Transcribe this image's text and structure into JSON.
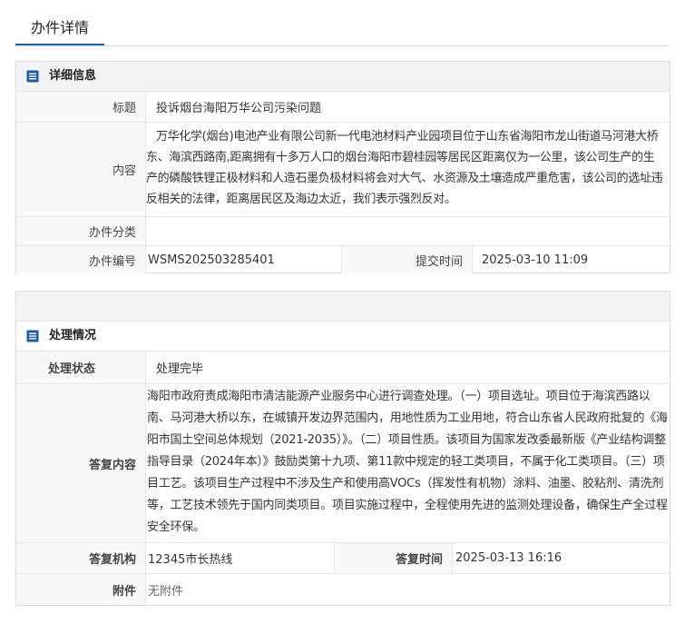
{
  "page_tab": "办件详情",
  "details": {
    "section_title": "详细信息",
    "title_label": "标题",
    "title_value": "投诉烟台海阳万华公司污染问题",
    "content_label": "内容",
    "content_value": "万华化学(烟台)电池产业有限公司新一代电池材料产业园项目位于山东省海阳市龙山街道马河港大桥东、海滨西路南,距离拥有十多万人口的烟台海阳市碧桂园等居民区距离仅为一公里，该公司生产的生产的磷酸铁锂正极材料和人造石墨负极材料将会对大气、水资源及土壤造成严重危害，该公司的选址违反相关的法律，距离居民区及海边太近，我们表示强烈反对。",
    "category_label": "办件分类",
    "category_value": "",
    "number_label": "办件编号",
    "number_value": "WSMS202503285401",
    "submit_time_label": "提交时间",
    "submit_time_value": "2025-03-10 11:09"
  },
  "handling": {
    "section_title": "处理情况",
    "status_label": "处理状态",
    "status_value": "处理完毕",
    "reply_label": "答复内容",
    "reply_value": "海阳市政府责成海阳市清洁能源产业服务中心进行调查处理。（一）项目选址。项目位于海滨西路以南、马河港大桥以东，在城镇开发边界范围内，用地性质为工业用地，符合山东省人民政府批复的《海阳市国土空间总体规划（2021-2035）》。（二）项目性质。该项目为国家发改委最新版《产业结构调整指导目录（2024年本）》鼓励类第十九项、第11款中规定的轻工类项目，不属于化工类项目。（三）项目工艺。该项目生产过程中不涉及生产和使用高VOCs（挥发性有机物）涂料、油墨、胶粘剂、清洗剂等，工艺技术领先于国内同类项目。项目实施过程中，全程使用先进的监测处理设备，确保生产全过程安全环保。",
    "org_label": "答复机构",
    "org_value": "12345市长热线",
    "reply_time_label": "答复时间",
    "reply_time_value": "2025-03-13 16:16",
    "attachment_label": "附件",
    "attachment_value": "无附件"
  }
}
